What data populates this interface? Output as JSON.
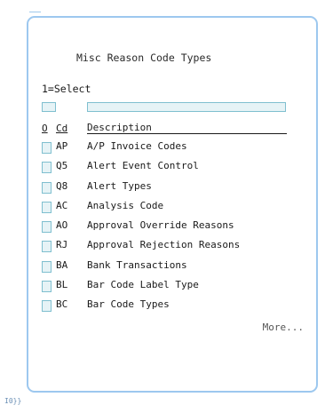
{
  "panel": {
    "title": "Misc Reason Code Types",
    "select_instruction": "1=Select",
    "more_label": "More..."
  },
  "columns": {
    "option": "O",
    "code": "Cd",
    "description": "Description"
  },
  "rows": [
    {
      "code": "AP",
      "description": "A/P Invoice Codes"
    },
    {
      "code": "Q5",
      "description": "Alert Event Control"
    },
    {
      "code": "Q8",
      "description": "Alert Types"
    },
    {
      "code": "AC",
      "description": "Analysis Code"
    },
    {
      "code": "AO",
      "description": "Approval Override Reasons"
    },
    {
      "code": "RJ",
      "description": "Approval Rejection Reasons"
    },
    {
      "code": "BA",
      "description": "Bank Transactions"
    },
    {
      "code": "BL",
      "description": "Bar Code Label Type"
    },
    {
      "code": "BC",
      "description": "Bar Code Types"
    }
  ],
  "footer": {
    "text": "I0}}"
  },
  "colors": {
    "panel_border": "#9dc8ef",
    "input_border": "#7fbfcf",
    "input_fill": "#e6f3f6"
  }
}
